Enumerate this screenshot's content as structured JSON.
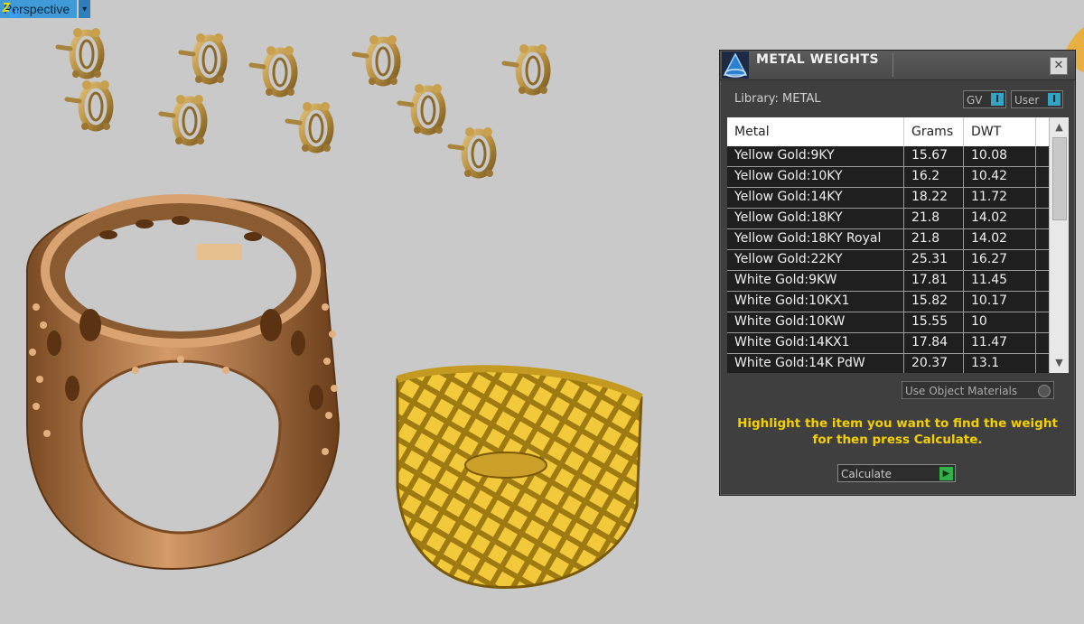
{
  "viewport": {
    "label": "Perspective",
    "dropdown_glyph": "▾",
    "axis_icon": "axis-icon"
  },
  "dialog": {
    "title": "METAL WEIGHTS",
    "close_glyph": "✕",
    "library_label": "Library: METAL",
    "toggles": {
      "gv_label": "GV",
      "user_label": "User",
      "knob_glyph": "I"
    },
    "table": {
      "headers": [
        "Metal",
        "Grams",
        "DWT"
      ],
      "rows": [
        [
          "Yellow Gold:9KY",
          "15.67",
          "10.08"
        ],
        [
          "Yellow Gold:10KY",
          "16.2",
          "10.42"
        ],
        [
          "Yellow Gold:14KY",
          "18.22",
          "11.72"
        ],
        [
          "Yellow Gold:18KY",
          "21.8",
          "14.02"
        ],
        [
          "Yellow Gold:18KY Royal",
          "21.8",
          "14.02"
        ],
        [
          "Yellow Gold:22KY",
          "25.31",
          "16.27"
        ],
        [
          "White Gold:9KW",
          "17.81",
          "11.45"
        ],
        [
          "White Gold:10KX1",
          "15.82",
          "10.17"
        ],
        [
          "White Gold:10KW",
          "15.55",
          "10"
        ],
        [
          "White Gold:14KX1",
          "17.84",
          "11.47"
        ],
        [
          "White Gold:14K PdW",
          "20.37",
          "13.1"
        ]
      ]
    },
    "object_materials_label": "Use Object Materials",
    "hint_line1": "Highlight the item you want to find the weight",
    "hint_line2": "for then press Calculate.",
    "calculate_label": "Calculate",
    "calculate_glyph": "▶"
  },
  "colors": {
    "viewport_bg": "#c9c9c9",
    "gold": "#c8a045",
    "copper": "#b57b4c",
    "accent_blue": "#3e9bd8",
    "hint_yellow": "#f4d000",
    "dialog_bg": "#3f3f3f"
  }
}
